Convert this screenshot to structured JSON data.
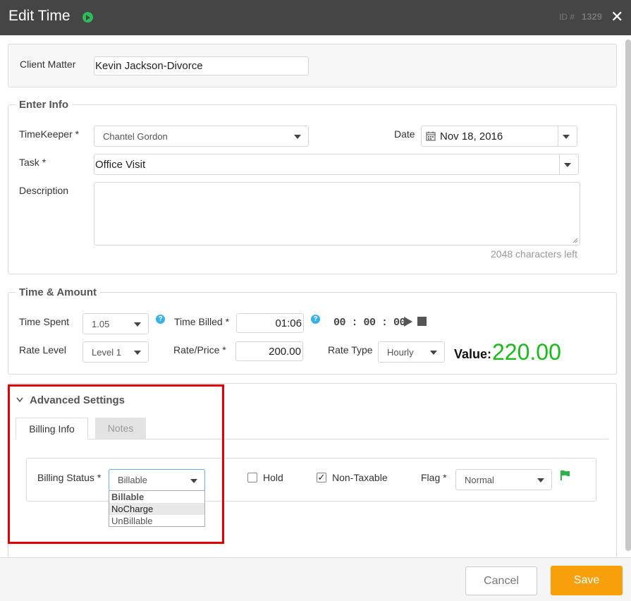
{
  "titlebar": {
    "title": "Edit Time",
    "id_label": "ID #",
    "id_value": "1329",
    "close": "✕"
  },
  "client_matter": {
    "label": "Client Matter",
    "value": "Kevin Jackson-Divorce"
  },
  "enter_info": {
    "legend": "Enter Info",
    "timekeeper_label": "TimeKeeper *",
    "timekeeper_value": "Chantel Gordon",
    "date_label": "Date",
    "date_value": "Nov 18, 2016",
    "task_label": "Task *",
    "task_value": "Office Visit",
    "description_label": "Description",
    "description_value": "",
    "chars_left": "2048 characters left"
  },
  "time_amount": {
    "legend": "Time & Amount",
    "time_spent_label": "Time Spent",
    "time_spent_value": "1.05",
    "time_billed_label": "Time Billed *",
    "time_billed_value": "01:06",
    "timer_display": "00 : 00 : 00",
    "rate_level_label": "Rate Level",
    "rate_level_value": "Level 1",
    "rate_price_label": "Rate/Price *",
    "rate_price_value": "200.00",
    "rate_type_label": "Rate Type",
    "rate_type_value": "Hourly",
    "value_label": "Value:",
    "value_amount": "220.00",
    "help_glyph": "?"
  },
  "advanced": {
    "title": "Advanced Settings",
    "tabs": [
      "Billing Info",
      "Notes"
    ],
    "billing_status_label": "Billing Status *",
    "billing_status_value": "Billable",
    "billing_status_options": [
      "Billable",
      "NoCharge",
      "UnBillable"
    ],
    "hold_label": "Hold",
    "hold_checked": false,
    "non_taxable_label": "Non-Taxable",
    "non_taxable_checked": true,
    "check_glyph": "✓",
    "flag_label": "Flag *",
    "flag_value": "Normal"
  },
  "footer": {
    "cancel": "Cancel",
    "save": "Save"
  },
  "colors": {
    "titlebar": "#454545",
    "value_green": "#1bb91b",
    "save_orange": "#f7a00c",
    "highlight_red": "#e00000",
    "flag_green": "#2bb24c"
  },
  "icons": {
    "play": "play-icon",
    "stop": "stop-icon",
    "calendar": "calendar-icon",
    "flag": "flag-icon",
    "chevron": "chevron-down-icon"
  }
}
